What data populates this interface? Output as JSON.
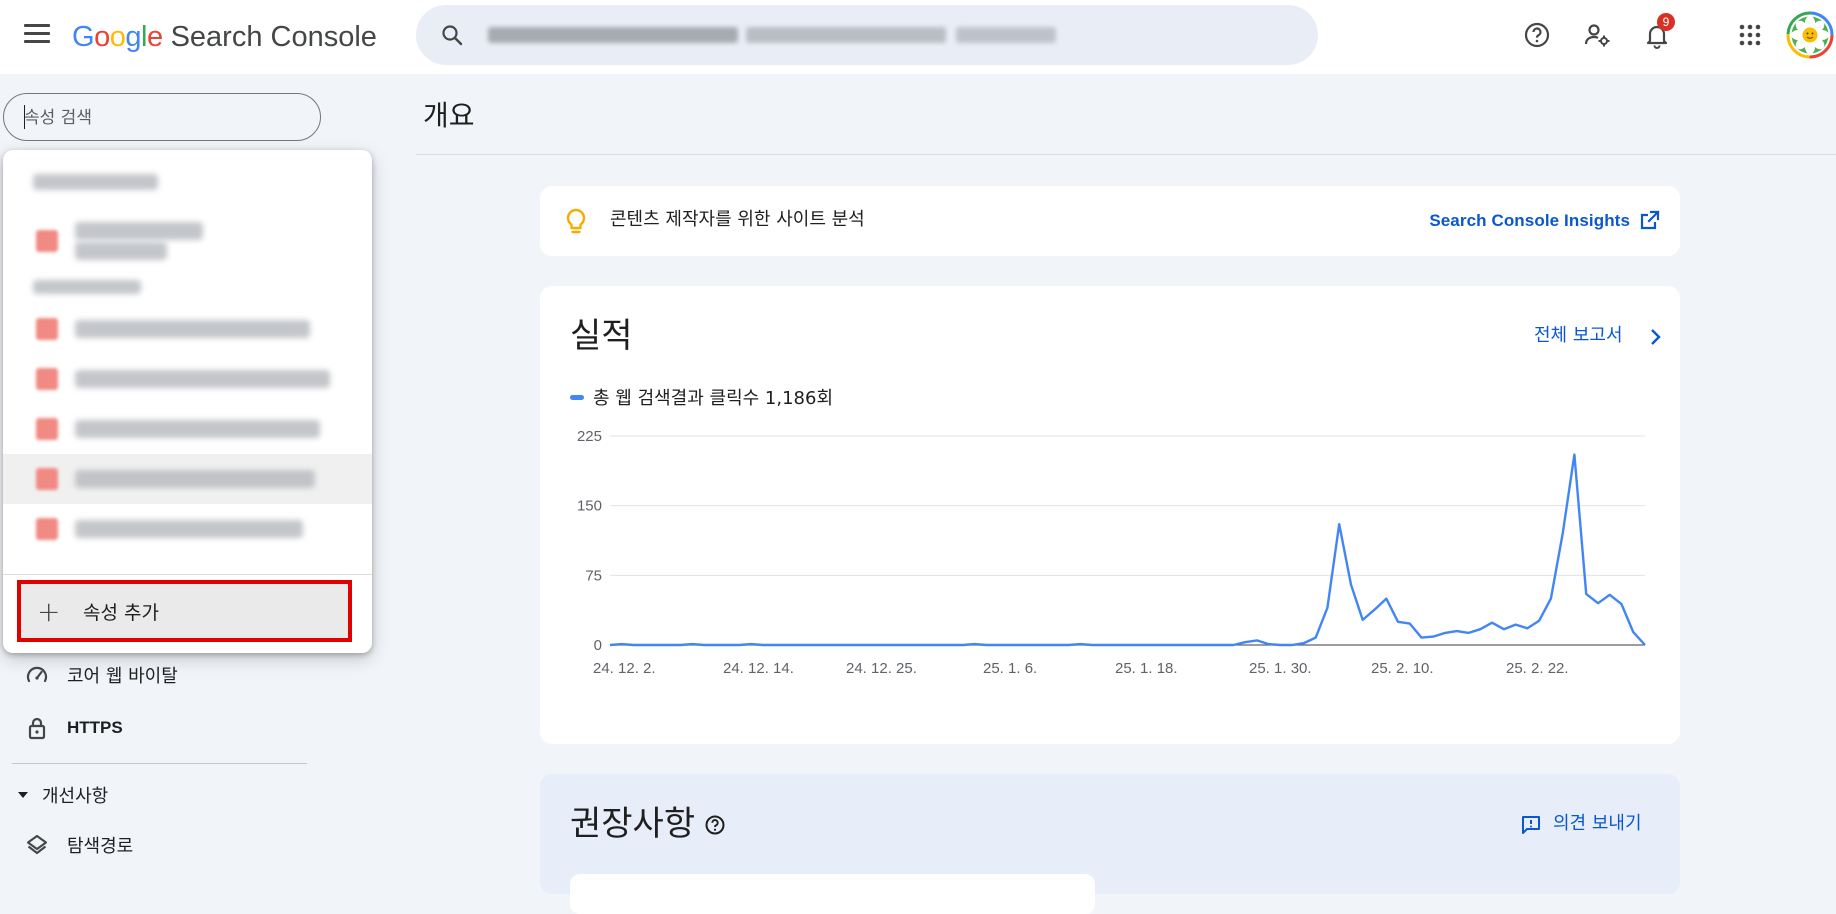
{
  "app": {
    "logo_letters": [
      "G",
      "o",
      "o",
      "g",
      "l",
      "e"
    ],
    "logo_colors": [
      "#4285f4",
      "#ea4335",
      "#fbbc05",
      "#4285f4",
      "#34a853",
      "#ea4335"
    ],
    "product_name": "Search Console"
  },
  "header": {
    "search_icon": "search-icon",
    "help_icon": "help-icon",
    "user_settings_icon": "user-settings-icon",
    "notifications_icon": "bell-icon",
    "notification_count": "9",
    "apps_icon": "apps-grid-icon",
    "avatar_icon": "flower-avatar-icon"
  },
  "sidebar": {
    "property_search_placeholder": "속성 검색",
    "add_property_label": "속성 추가",
    "nav_items": [
      {
        "label": "코어 웹 바이탈",
        "icon": "speed-gauge-icon"
      },
      {
        "label": "HTTPS",
        "icon": "lock-icon"
      }
    ],
    "section_label": "개선사항",
    "section_items": [
      {
        "label": "탐색경로",
        "icon": "layers-icon"
      }
    ]
  },
  "main": {
    "page_title": "개요",
    "insights": {
      "text": "콘텐츠 제작자를 위한 사이트 분석",
      "link_label": "Search Console Insights"
    },
    "performance": {
      "title": "실적",
      "full_report_label": "전체 보고서",
      "legend_label": "총 웹 검색결과 클릭수 1,186회"
    },
    "recommendations": {
      "title": "권장사항",
      "feedback_label": "의견 보내기"
    }
  },
  "colors": {
    "accent_blue": "#0b57d0",
    "series_blue": "#4285f4",
    "highlight_red": "#e00000"
  },
  "chart_data": {
    "type": "line",
    "ylim": [
      0,
      225
    ],
    "y_ticks": [
      0,
      75,
      150,
      225
    ],
    "x_tick_labels": [
      "24. 12. 2.",
      "24. 12. 14.",
      "24. 12. 25.",
      "25. 1. 6.",
      "25. 1. 18.",
      "25. 1. 30.",
      "25. 2. 10.",
      "25. 2. 22."
    ],
    "grid": true,
    "series": [
      {
        "values": [
          0,
          1,
          0,
          0,
          0,
          0,
          0,
          1,
          0,
          0,
          0,
          0,
          1,
          0,
          0,
          0,
          0,
          0,
          0,
          0,
          0,
          0,
          0,
          0,
          0,
          0,
          0,
          0,
          0,
          0,
          0,
          1,
          0,
          0,
          0,
          0,
          0,
          0,
          0,
          0,
          1,
          0,
          0,
          0,
          0,
          0,
          0,
          0,
          0,
          0,
          0,
          0,
          0,
          0,
          3,
          5,
          1,
          0,
          0,
          2,
          8,
          40,
          130,
          65,
          27,
          38,
          50,
          25,
          23,
          8,
          9,
          13,
          15,
          13,
          17,
          24,
          17,
          22,
          18,
          26,
          50,
          120,
          205,
          55,
          45,
          54,
          44,
          14,
          0
        ]
      }
    ]
  }
}
